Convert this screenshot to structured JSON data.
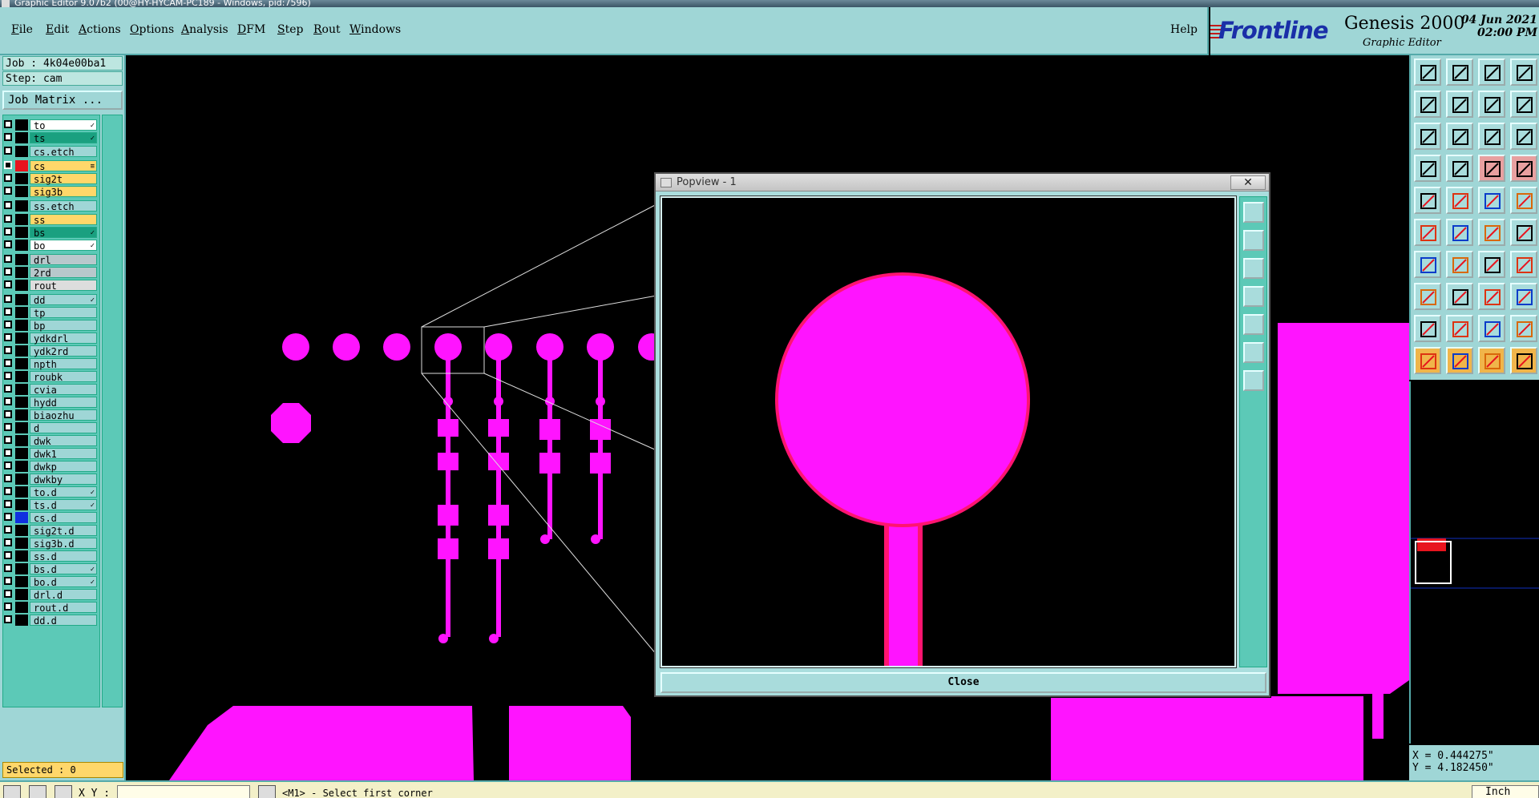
{
  "titlebar": {
    "title": "Graphic Editor 9.07b2 (00@HY-HYCAM-PC189 - Windows, pid:7596)"
  },
  "menu": {
    "items": [
      "File",
      "Edit",
      "Actions",
      "Options",
      "Analysis",
      "DFM",
      "Step",
      "Rout",
      "Windows"
    ],
    "help": "Help"
  },
  "brand": {
    "logo": "Frontline",
    "product": "Genesis 2000",
    "subtitle": "Graphic Editor",
    "date": "04 Jun 2021",
    "time": "02:00 PM"
  },
  "job": {
    "job_label": "Job : 4k04e00ba1",
    "step_label": "Step: cam",
    "matrix_button": "Job Matrix ..."
  },
  "layers": [
    {
      "name": "to",
      "color": "#ffffff",
      "swatch": "#000000",
      "mark": "✓"
    },
    {
      "name": "ts",
      "color": "#1aa080",
      "swatch": "#000000",
      "mark": "✓"
    },
    {
      "name": "cs.etch",
      "color": "#9fd6d6",
      "swatch": "#000000",
      "mark": ""
    },
    {
      "name": "cs",
      "color": "#ffd76a",
      "swatch": "#e8141e",
      "mark": "≡"
    },
    {
      "name": "sig2t",
      "color": "#ffd76a",
      "swatch": "#000000",
      "mark": ""
    },
    {
      "name": "sig3b",
      "color": "#ffd76a",
      "swatch": "#000000",
      "mark": ""
    },
    {
      "name": "ss.etch",
      "color": "#9fd6d6",
      "swatch": "#000000",
      "mark": ""
    },
    {
      "name": "ss",
      "color": "#ffd76a",
      "swatch": "#000000",
      "mark": ""
    },
    {
      "name": "bs",
      "color": "#1aa080",
      "swatch": "#000000",
      "mark": "✓"
    },
    {
      "name": "bo",
      "color": "#ffffff",
      "swatch": "#000000",
      "mark": "✓"
    },
    {
      "name": "drl",
      "color": "#b8c8cc",
      "swatch": "#000000",
      "mark": ""
    },
    {
      "name": "2rd",
      "color": "#b8c8cc",
      "swatch": "#000000",
      "mark": ""
    },
    {
      "name": "rout",
      "color": "#dddddd",
      "swatch": "#000000",
      "mark": ""
    },
    {
      "name": "dd",
      "color": "#9fd6d6",
      "swatch": "#000000",
      "mark": "✓"
    },
    {
      "name": "tp",
      "color": "#9fd6d6",
      "swatch": "#000000",
      "mark": ""
    },
    {
      "name": "bp",
      "color": "#9fd6d6",
      "swatch": "#000000",
      "mark": ""
    },
    {
      "name": "ydkdrl",
      "color": "#9fd6d6",
      "swatch": "#000000",
      "mark": ""
    },
    {
      "name": "ydk2rd",
      "color": "#9fd6d6",
      "swatch": "#000000",
      "mark": ""
    },
    {
      "name": "npth",
      "color": "#9fd6d6",
      "swatch": "#000000",
      "mark": ""
    },
    {
      "name": "roubk",
      "color": "#9fd6d6",
      "swatch": "#000000",
      "mark": ""
    },
    {
      "name": "cvia",
      "color": "#9fd6d6",
      "swatch": "#000000",
      "mark": ""
    },
    {
      "name": "hydd",
      "color": "#9fd6d6",
      "swatch": "#000000",
      "mark": ""
    },
    {
      "name": "biaozhu",
      "color": "#9fd6d6",
      "swatch": "#000000",
      "mark": ""
    },
    {
      "name": "d",
      "color": "#9fd6d6",
      "swatch": "#000000",
      "mark": ""
    },
    {
      "name": "dwk",
      "color": "#9fd6d6",
      "swatch": "#000000",
      "mark": ""
    },
    {
      "name": "dwk1",
      "color": "#9fd6d6",
      "swatch": "#000000",
      "mark": ""
    },
    {
      "name": "dwkp",
      "color": "#9fd6d6",
      "swatch": "#000000",
      "mark": ""
    },
    {
      "name": "dwkby",
      "color": "#9fd6d6",
      "swatch": "#000000",
      "mark": ""
    },
    {
      "name": "to.d",
      "color": "#9fd6d6",
      "swatch": "#000000",
      "mark": "✓"
    },
    {
      "name": "ts.d",
      "color": "#9fd6d6",
      "swatch": "#000000",
      "mark": "✓"
    },
    {
      "name": "cs.d",
      "color": "#9fd6d6",
      "swatch": "#1030e0",
      "mark": ""
    },
    {
      "name": "sig2t.d",
      "color": "#9fd6d6",
      "swatch": "#000000",
      "mark": ""
    },
    {
      "name": "sig3b.d",
      "color": "#9fd6d6",
      "swatch": "#000000",
      "mark": ""
    },
    {
      "name": "ss.d",
      "color": "#9fd6d6",
      "swatch": "#000000",
      "mark": ""
    },
    {
      "name": "bs.d",
      "color": "#9fd6d6",
      "swatch": "#000000",
      "mark": "✓"
    },
    {
      "name": "bo.d",
      "color": "#9fd6d6",
      "swatch": "#000000",
      "mark": "✓"
    },
    {
      "name": "drl.d",
      "color": "#9fd6d6",
      "swatch": "#000000",
      "mark": ""
    },
    {
      "name": "rout.d",
      "color": "#9fd6d6",
      "swatch": "#000000",
      "mark": ""
    },
    {
      "name": "dd.d",
      "color": "#9fd6d6",
      "swatch": "#000000",
      "mark": ""
    }
  ],
  "selected": "Selected : 0",
  "popview": {
    "title": "Popview - 1",
    "close_x": "✕",
    "close_button": "Close"
  },
  "coords": {
    "x": "X = 0.444275\"",
    "y": "Y = 4.182450\""
  },
  "status": {
    "xy_label": "X Y :",
    "xy_value": "",
    "prompt": "<M1> - Select first corner",
    "units": "Inch"
  },
  "colors": {
    "copper": "#ff14ff",
    "panel": "#9fd6d6",
    "active_layer": "#e8141e"
  },
  "toolbar_icons": [
    "zoom-home-icon",
    "zoom-back-icon",
    "home-icon",
    "grid-icon",
    "pan-left-icon",
    "pan-right-icon",
    "zoom-window-icon",
    "snap-icon",
    "fit-icon",
    "fit-profile-icon",
    "scale-1-2-icon",
    "help-icon",
    "measure-icon",
    "grid-display-icon",
    "net-icon",
    "net-select-icon",
    "pad-icon",
    "line-icon",
    "dash-icon",
    "circle-icon",
    "node-icon",
    "cross-icon",
    "connect-icon",
    "route-icon",
    "angle-icon",
    "slash-icon",
    "arc-icon",
    "flip-icon",
    "move-icon",
    "minus-icon",
    "resize-icon",
    "copy-icon",
    "triangle-icon",
    "text-a-icon",
    "text-b-icon",
    "text-c-icon",
    "pointer-icon",
    "pointer-select-icon",
    "pointer-move-icon",
    "pointer-multi-icon"
  ]
}
